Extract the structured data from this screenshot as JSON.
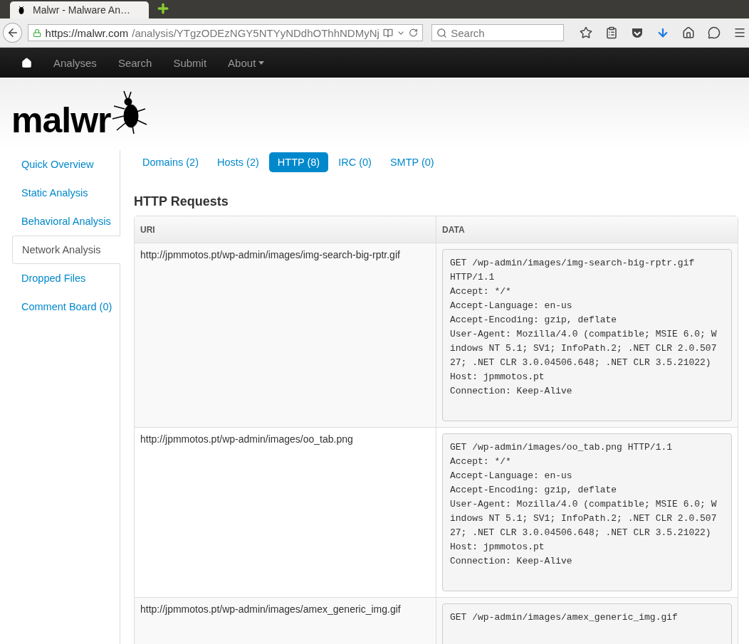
{
  "browser": {
    "tab_title": "Malwr - Malware An…",
    "url_host": "https://malwr.com",
    "url_path": "/analysis/YTgzODEzNGY5NTYyNDdhOThhNDMyNj",
    "search_placeholder": "Search"
  },
  "navbar": {
    "items": [
      {
        "label": "Analyses",
        "kind": "link"
      },
      {
        "label": "Search",
        "kind": "link"
      },
      {
        "label": "Submit",
        "kind": "link"
      },
      {
        "label": "About",
        "kind": "dropdown"
      }
    ]
  },
  "logo": {
    "text": "malwr"
  },
  "sidebar": {
    "items": [
      {
        "label": "Quick Overview",
        "selected": false
      },
      {
        "label": "Static Analysis",
        "selected": false
      },
      {
        "label": "Behavioral Analysis",
        "selected": false
      },
      {
        "label": "Network Analysis",
        "selected": true
      },
      {
        "label": "Dropped Files",
        "selected": false
      },
      {
        "label": "Comment Board (0)",
        "selected": false
      }
    ]
  },
  "tabs": [
    {
      "label": "Domains (2)",
      "selected": false
    },
    {
      "label": "Hosts (2)",
      "selected": false
    },
    {
      "label": "HTTP (8)",
      "selected": true
    },
    {
      "label": "IRC (0)",
      "selected": false
    },
    {
      "label": "SMTP (0)",
      "selected": false
    }
  ],
  "section_title": "HTTP Requests",
  "table": {
    "columns": [
      "URI",
      "DATA"
    ],
    "rows": [
      {
        "uri": "http://jpmmotos.pt/wp-admin/images/img-search-big-rptr.gif",
        "data": [
          "GET /wp-admin/images/img-search-big-rptr.gif",
          "HTTP/1.1",
          "Accept: */*",
          "Accept-Language: en-us",
          "Accept-Encoding: gzip, deflate",
          "User-Agent: Mozilla/4.0 (compatible; MSIE 6.0; W",
          "indows NT 5.1; SV1; InfoPath.2; .NET CLR 2.0.507",
          "27; .NET CLR 3.0.04506.648; .NET CLR 3.5.21022)",
          "Host: jpmmotos.pt",
          "Connection: Keep-Alive"
        ]
      },
      {
        "uri": "http://jpmmotos.pt/wp-admin/images/oo_tab.png",
        "data": [
          "GET /wp-admin/images/oo_tab.png HTTP/1.1",
          "Accept: */*",
          "Accept-Language: en-us",
          "Accept-Encoding: gzip, deflate",
          "User-Agent: Mozilla/4.0 (compatible; MSIE 6.0; W",
          "indows NT 5.1; SV1; InfoPath.2; .NET CLR 2.0.507",
          "27; .NET CLR 3.0.04506.648; .NET CLR 3.5.21022)",
          "Host: jpmmotos.pt",
          "Connection: Keep-Alive"
        ]
      },
      {
        "uri": "http://jpmmotos.pt/wp-admin/images/amex_generic_img.gif",
        "data": [
          "GET /wp-admin/images/amex_generic_img.gif"
        ]
      }
    ]
  }
}
